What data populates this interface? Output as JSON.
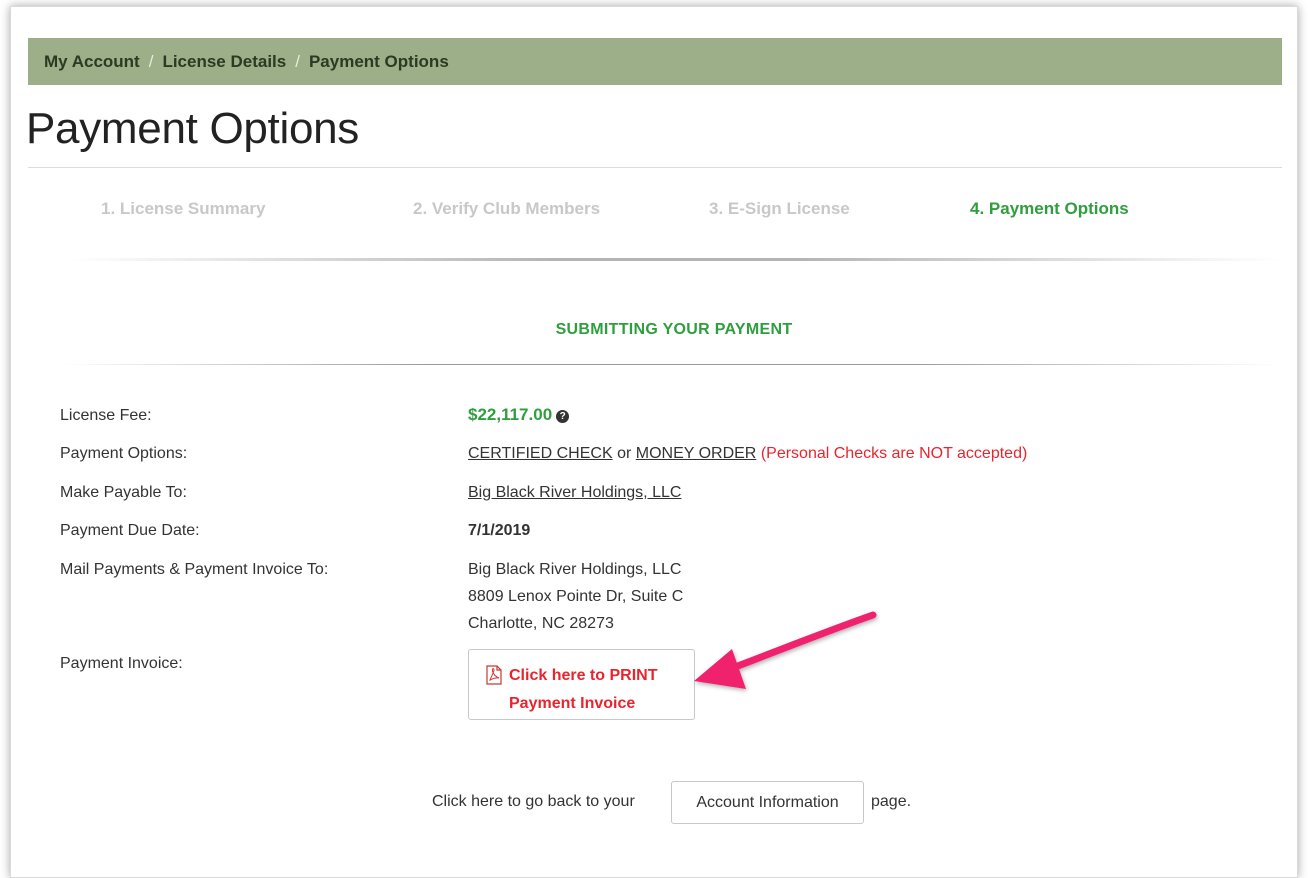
{
  "breadcrumb": {
    "items": [
      "My Account",
      "License Details",
      "Payment Options"
    ],
    "separator": "/"
  },
  "page_title": "Payment Options",
  "steps": [
    {
      "label": "1. License Summary",
      "state": "inactive"
    },
    {
      "label": "2. Verify Club Members",
      "state": "inactive"
    },
    {
      "label": "3. E-Sign License",
      "state": "inactive"
    },
    {
      "label": "4. Payment Options",
      "state": "active"
    }
  ],
  "section_title": "SUBMITTING YOUR PAYMENT",
  "details": {
    "license_fee_label": "License Fee:",
    "license_fee_value": "$22,117.00",
    "help_icon_glyph": "?",
    "payment_options_label": "Payment Options:",
    "payment_option_1": "CERTIFIED CHECK",
    "payment_or": "or",
    "payment_option_2": "MONEY ORDER",
    "payment_note": "(Personal Checks are NOT accepted)",
    "payable_label": "Make Payable To:",
    "payable_value": "Big Black River Holdings, LLC",
    "due_label": "Payment Due Date:",
    "due_value": "7/1/2019",
    "mail_label": "Mail Payments & Payment Invoice To:",
    "mail_address": [
      "Big Black River Holdings, LLC",
      "8809 Lenox Pointe Dr, Suite C",
      "Charlotte, NC 28273"
    ],
    "invoice_label": "Payment Invoice:",
    "invoice_button_line1": "Click here to PRINT",
    "invoice_button_line2": "Payment Invoice"
  },
  "footer": {
    "prefix": "Click here to go back to your",
    "button": "Account Information",
    "suffix": "page."
  },
  "colors": {
    "breadcrumb_bg": "#9caf88",
    "accent_green": "#2e9e3e",
    "warning_red": "#e8252e",
    "annotation_arrow": "#f0236e"
  },
  "icons": {
    "pdf": "pdf-icon",
    "help": "help-circle-icon",
    "annotation": "annotation-arrow"
  }
}
